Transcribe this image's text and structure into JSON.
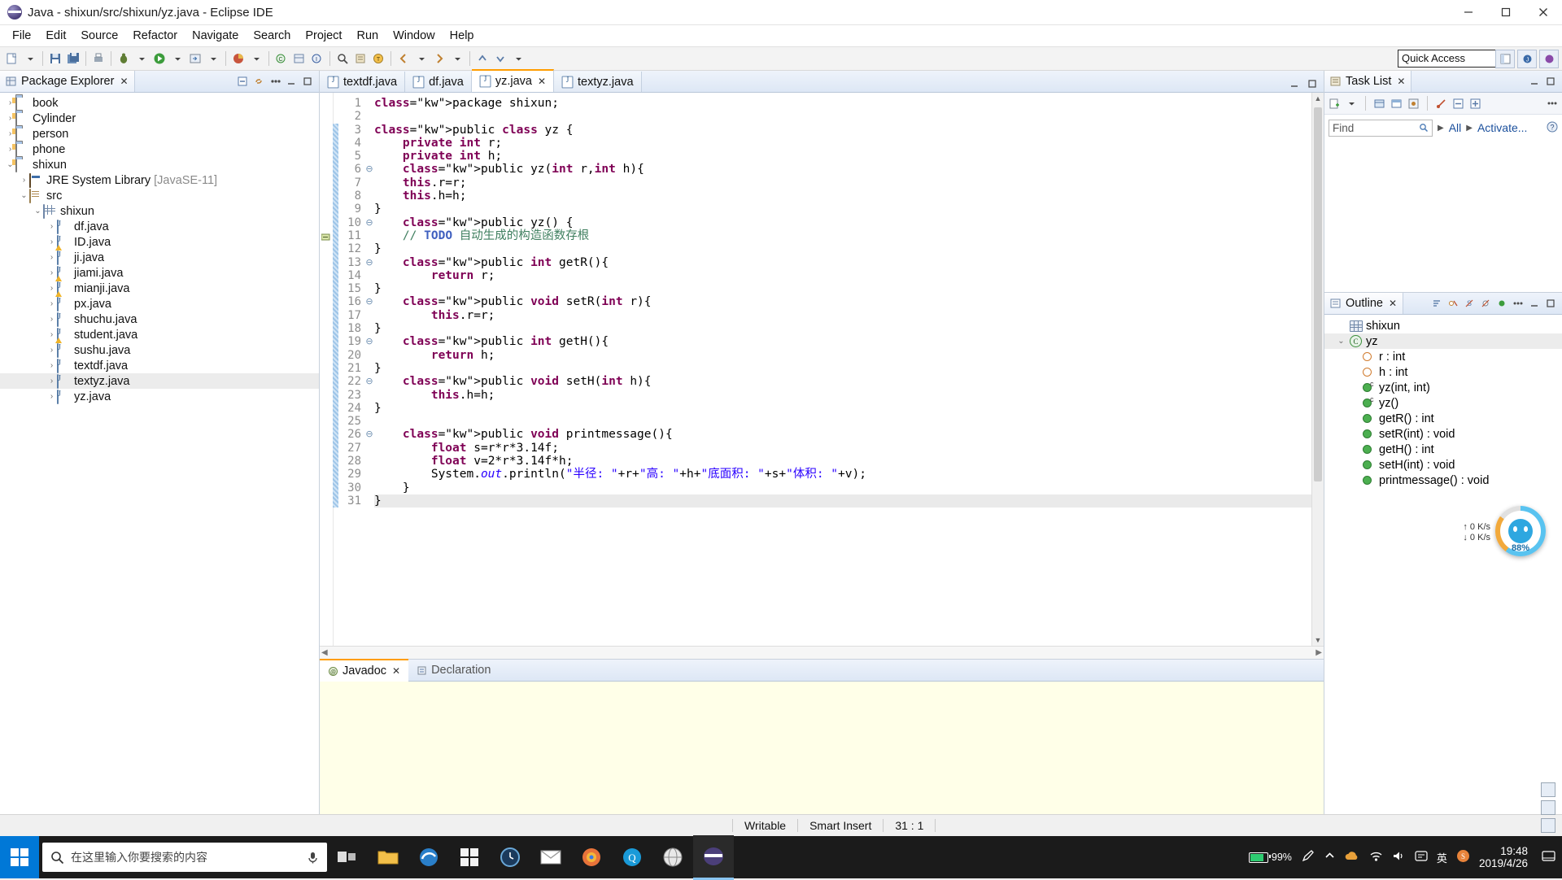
{
  "window": {
    "title": "Java - shixun/src/shixun/yz.java - Eclipse IDE",
    "minimize": "—",
    "maximize": "▢",
    "close": "✕"
  },
  "menu": [
    "File",
    "Edit",
    "Source",
    "Refactor",
    "Navigate",
    "Search",
    "Project",
    "Run",
    "Window",
    "Help"
  ],
  "toolbar": {
    "quick_access": "Quick Access"
  },
  "package_explorer": {
    "title": "Package Explorer",
    "close_glyph": "✕",
    "items": [
      {
        "label": "book",
        "indent": 0,
        "arrow": "›",
        "icon": "project-icon"
      },
      {
        "label": "Cylinder",
        "indent": 0,
        "arrow": "›",
        "icon": "project-icon"
      },
      {
        "label": "person",
        "indent": 0,
        "arrow": "›",
        "icon": "project-icon"
      },
      {
        "label": "phone",
        "indent": 0,
        "arrow": "›",
        "icon": "project-icon"
      },
      {
        "label": "shixun",
        "indent": 0,
        "arrow": "⌄",
        "icon": "project-icon"
      },
      {
        "label": "JRE System Library",
        "suffix": " [JavaSE-11]",
        "indent": 1,
        "arrow": "›",
        "icon": "library-icon"
      },
      {
        "label": "src",
        "indent": 1,
        "arrow": "⌄",
        "icon": "source-folder-icon"
      },
      {
        "label": "shixun",
        "indent": 2,
        "arrow": "⌄",
        "icon": "package-icon"
      },
      {
        "label": "df.java",
        "indent": 3,
        "arrow": "›",
        "icon": "java-file-icon"
      },
      {
        "label": "ID.java",
        "indent": 3,
        "arrow": "›",
        "icon": "java-file-warning-icon"
      },
      {
        "label": "ji.java",
        "indent": 3,
        "arrow": "›",
        "icon": "java-file-icon"
      },
      {
        "label": "jiami.java",
        "indent": 3,
        "arrow": "›",
        "icon": "java-file-warning-icon"
      },
      {
        "label": "mianji.java",
        "indent": 3,
        "arrow": "›",
        "icon": "java-file-warning-icon"
      },
      {
        "label": "px.java",
        "indent": 3,
        "arrow": "›",
        "icon": "java-file-icon"
      },
      {
        "label": "shuchu.java",
        "indent": 3,
        "arrow": "›",
        "icon": "java-file-icon"
      },
      {
        "label": "student.java",
        "indent": 3,
        "arrow": "›",
        "icon": "java-file-warning-icon"
      },
      {
        "label": "sushu.java",
        "indent": 3,
        "arrow": "›",
        "icon": "java-file-icon"
      },
      {
        "label": "textdf.java",
        "indent": 3,
        "arrow": "›",
        "icon": "java-file-icon"
      },
      {
        "label": "textyz.java",
        "indent": 3,
        "arrow": "›",
        "icon": "java-file-icon",
        "selected": true
      },
      {
        "label": "yz.java",
        "indent": 3,
        "arrow": "›",
        "icon": "java-file-icon"
      }
    ]
  },
  "editor": {
    "tabs": [
      {
        "label": "textdf.java",
        "active": false
      },
      {
        "label": "df.java",
        "active": false
      },
      {
        "label": "yz.java",
        "active": true,
        "close": "✕"
      },
      {
        "label": "textyz.java",
        "active": false
      }
    ],
    "lines": [
      {
        "n": "1",
        "fold": "",
        "text": "package shixun;"
      },
      {
        "n": "2",
        "fold": "",
        "text": ""
      },
      {
        "n": "3",
        "fold": "",
        "text": "public class yz {"
      },
      {
        "n": "4",
        "fold": "",
        "text": "    private int r;"
      },
      {
        "n": "5",
        "fold": "",
        "text": "    private int h;"
      },
      {
        "n": "6",
        "fold": "⊖",
        "text": "    public yz(int r,int h){"
      },
      {
        "n": "7",
        "fold": "",
        "text": "    this.r=r;"
      },
      {
        "n": "8",
        "fold": "",
        "text": "    this.h=h;"
      },
      {
        "n": "9",
        "fold": "",
        "text": "}"
      },
      {
        "n": "10",
        "fold": "⊖",
        "text": "    public yz() {"
      },
      {
        "n": "11",
        "fold": "",
        "text": "    // TODO 自动生成的构造函数存根"
      },
      {
        "n": "12",
        "fold": "",
        "text": "}"
      },
      {
        "n": "13",
        "fold": "⊖",
        "text": "    public int getR(){"
      },
      {
        "n": "14",
        "fold": "",
        "text": "        return r;"
      },
      {
        "n": "15",
        "fold": "",
        "text": "}"
      },
      {
        "n": "16",
        "fold": "⊖",
        "text": "    public void setR(int r){"
      },
      {
        "n": "17",
        "fold": "",
        "text": "        this.r=r;"
      },
      {
        "n": "18",
        "fold": "",
        "text": "}"
      },
      {
        "n": "19",
        "fold": "⊖",
        "text": "    public int getH(){"
      },
      {
        "n": "20",
        "fold": "",
        "text": "        return h;"
      },
      {
        "n": "21",
        "fold": "",
        "text": "}"
      },
      {
        "n": "22",
        "fold": "⊖",
        "text": "    public void setH(int h){"
      },
      {
        "n": "23",
        "fold": "",
        "text": "        this.h=h;"
      },
      {
        "n": "24",
        "fold": "",
        "text": "}"
      },
      {
        "n": "25",
        "fold": "",
        "text": ""
      },
      {
        "n": "26",
        "fold": "⊖",
        "text": "    public void printmessage(){"
      },
      {
        "n": "27",
        "fold": "",
        "text": "        float s=r*r*3.14f;"
      },
      {
        "n": "28",
        "fold": "",
        "text": "        float v=2*r*3.14f*h;"
      },
      {
        "n": "29",
        "fold": "",
        "text": "        System.out.println(\"半径: \"+r+\"高: \"+h+\"底面积: \"+s+\"体积: \"+v);"
      },
      {
        "n": "30",
        "fold": "",
        "text": "    }"
      },
      {
        "n": "31",
        "fold": "",
        "text": "}"
      }
    ]
  },
  "javadoc": {
    "tabs": [
      {
        "label": "Javadoc",
        "active": true,
        "close": "✕"
      },
      {
        "label": "Declaration",
        "active": false
      }
    ]
  },
  "task_list": {
    "title": "Task List",
    "close_glyph": "✕",
    "find_placeholder": "Find",
    "all_label": "All",
    "activate_label": "Activate..."
  },
  "outline": {
    "title": "Outline",
    "close_glyph": "✕",
    "items": [
      {
        "label": "shixun",
        "kind": "package",
        "indent": 0,
        "arrow": ""
      },
      {
        "label": "yz",
        "kind": "class",
        "indent": 0,
        "arrow": "⌄",
        "selected": true
      },
      {
        "label": "r : int",
        "kind": "field-private",
        "indent": 1,
        "arrow": ""
      },
      {
        "label": "h : int",
        "kind": "field-private",
        "indent": 1,
        "arrow": ""
      },
      {
        "label": "yz(int, int)",
        "kind": "constructor",
        "indent": 1,
        "arrow": ""
      },
      {
        "label": "yz()",
        "kind": "constructor",
        "indent": 1,
        "arrow": ""
      },
      {
        "label": "getR() : int",
        "kind": "method",
        "indent": 1,
        "arrow": ""
      },
      {
        "label": "setR(int) : void",
        "kind": "method",
        "indent": 1,
        "arrow": ""
      },
      {
        "label": "getH() : int",
        "kind": "method",
        "indent": 1,
        "arrow": ""
      },
      {
        "label": "setH(int) : void",
        "kind": "method",
        "indent": 1,
        "arrow": ""
      },
      {
        "label": "printmessage() : void",
        "kind": "method",
        "indent": 1,
        "arrow": ""
      }
    ]
  },
  "status_bar": {
    "writable": "Writable",
    "insert_mode": "Smart Insert",
    "position": "31 : 1"
  },
  "network_monitor": {
    "up": "↑ 0  K/s",
    "down": "↓ 0  K/s"
  },
  "floating_ball": {
    "percent": "88%"
  },
  "taskbar": {
    "search_placeholder": "在这里输入你要搜索的内容",
    "battery": "99%",
    "ime": "英",
    "time": "19:48",
    "date": "2019/4/26"
  }
}
